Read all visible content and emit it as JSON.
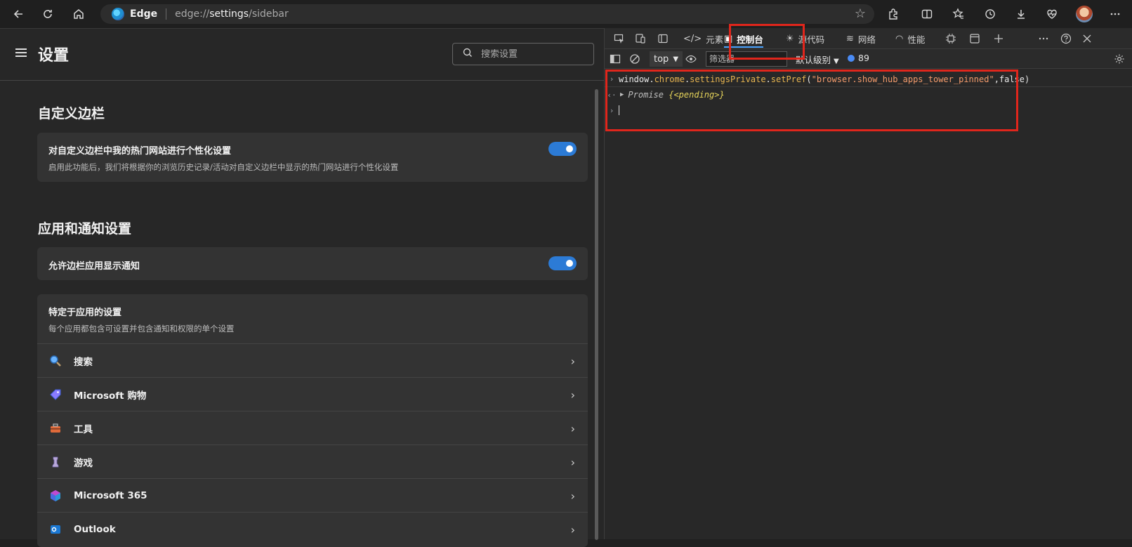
{
  "browser": {
    "site_name": "Edge",
    "url_prefix": "edge://",
    "url_host": "settings",
    "url_path": "/sidebar"
  },
  "settings": {
    "title": "设置",
    "search_placeholder": "搜索设置",
    "section1_title": "自定义边栏",
    "card1_title": "对自定义边栏中我的热门网站进行个性化设置",
    "card1_desc": "启用此功能后，我们将根据你的浏览历史记录/活动对自定义边栏中显示的热门网站进行个性化设置",
    "card1_toggle_on": true,
    "section2_title": "应用和通知设置",
    "card2_title": "允许边栏应用显示通知",
    "card2_toggle_on": true,
    "card3_title": "特定于应用的设置",
    "card3_desc": "每个应用都包含可设置并包含通知和权限的单个设置",
    "apps": [
      {
        "label": "搜索",
        "icon": "search-app-icon"
      },
      {
        "label": "Microsoft 购物",
        "icon": "shopping-tag-icon"
      },
      {
        "label": "工具",
        "icon": "toolbox-icon"
      },
      {
        "label": "游戏",
        "icon": "chess-piece-icon"
      },
      {
        "label": "Microsoft 365",
        "icon": "m365-icon"
      },
      {
        "label": "Outlook",
        "icon": "outlook-icon"
      }
    ]
  },
  "devtools": {
    "tabs": [
      {
        "label": "元素",
        "icon": "</>"
      },
      {
        "label": "控制台",
        "icon": "▣"
      },
      {
        "label": "源代码",
        "icon": "☀"
      },
      {
        "label": "网络",
        "icon": "≋"
      },
      {
        "label": "性能",
        "icon": "◠"
      }
    ],
    "active_tab": "控制台",
    "context": "top",
    "filter_placeholder": "筛选器",
    "levels_label": "默认级别",
    "message_count": "89",
    "console": {
      "cmd_obj": "window.",
      "cmd_chrome": "chrome",
      "cmd_dot1": ".",
      "cmd_sp": "settingsPrivate",
      "cmd_dot2": ".",
      "cmd_fn": "setPref",
      "cmd_open": "(",
      "cmd_str": "\"browser.show_hub_apps_tower_pinned\"",
      "cmd_rest": ",false)",
      "result_type": "Promise",
      "result_state": "{<pending>}"
    }
  },
  "colors": {
    "highlight": "#e0261c",
    "toggle_on": "#2c7bd6",
    "accent_tab": "#4aa3ff"
  }
}
